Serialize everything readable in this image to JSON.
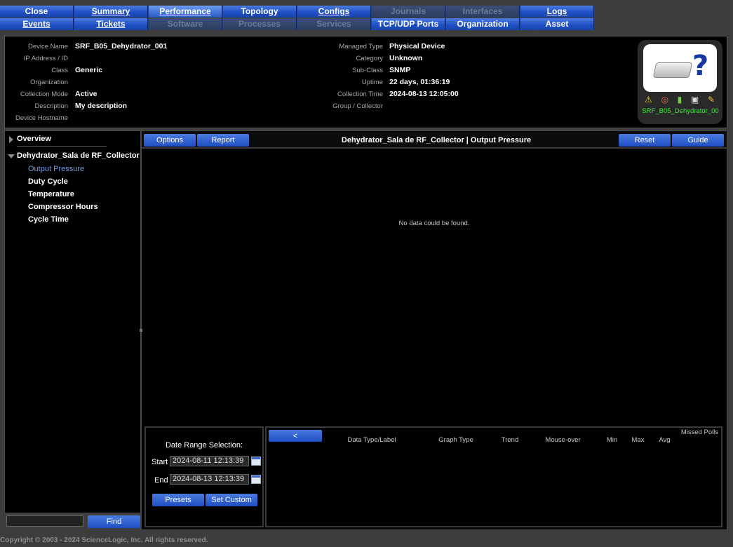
{
  "tabs_row1": [
    {
      "label": "Close",
      "accel": "",
      "state": "normal"
    },
    {
      "label": "Summary",
      "accel": "S",
      "state": "normal"
    },
    {
      "label": "Performance",
      "accel": "P",
      "state": "active"
    },
    {
      "label": "Topology",
      "accel": "o",
      "state": "normal"
    },
    {
      "label": "Configs",
      "accel": "C",
      "state": "normal"
    },
    {
      "label": "Journals",
      "accel": "",
      "state": "disabled"
    },
    {
      "label": "Interfaces",
      "accel": "",
      "state": "disabled"
    },
    {
      "label": "Logs",
      "accel": "L",
      "state": "normal"
    }
  ],
  "tabs_row2": [
    {
      "label": "Events",
      "accel": "E",
      "state": "normal"
    },
    {
      "label": "Tickets",
      "accel": "T",
      "state": "normal"
    },
    {
      "label": "Software",
      "accel": "",
      "state": "disabled"
    },
    {
      "label": "Processes",
      "accel": "",
      "state": "disabled"
    },
    {
      "label": "Services",
      "accel": "",
      "state": "disabled"
    },
    {
      "label": "TCP/UDP Ports",
      "accel": "",
      "state": "normal"
    },
    {
      "label": "Organization",
      "accel": "",
      "state": "normal"
    },
    {
      "label": "Asset",
      "accel": "",
      "state": "normal"
    }
  ],
  "device": {
    "left": [
      {
        "key": "Device Name",
        "value": "SRF_B05_Dehydrator_001"
      },
      {
        "key": "IP Address / ID",
        "value": ""
      },
      {
        "key": "Class",
        "value": "Generic"
      },
      {
        "key": "Organization",
        "value": ""
      },
      {
        "key": "Collection Mode",
        "value": "Active"
      },
      {
        "key": "Description",
        "value": "My description"
      },
      {
        "key": "Device Hostname",
        "value": ""
      }
    ],
    "right": [
      {
        "key": "Managed Type",
        "value": "Physical Device"
      },
      {
        "key": "Category",
        "value": "Unknown"
      },
      {
        "key": "Sub-Class",
        "value": "SNMP"
      },
      {
        "key": "Uptime",
        "value": "22 days, 01:36:19"
      },
      {
        "key": "Collection Time",
        "value": "2024-08-13 12:05:00"
      },
      {
        "key": "Group / Collector",
        "value": ""
      }
    ],
    "badge_name": "SRF_B05_Dehydrator_00"
  },
  "nav": {
    "overview": "Overview",
    "group": "Dehydrator_Sala de RF_Collector",
    "items": [
      {
        "label": "Output Pressure",
        "selected": true
      },
      {
        "label": "Duty Cycle",
        "selected": false
      },
      {
        "label": "Temperature",
        "selected": false
      },
      {
        "label": "Compressor Hours",
        "selected": false
      },
      {
        "label": "Cycle Time",
        "selected": false
      }
    ],
    "find_label": "Find"
  },
  "toolbar": {
    "options": "Options",
    "report": "Report",
    "title": "Dehydrator_Sala de RF_Collector | Output Pressure",
    "reset": "Reset",
    "guide": "Guide"
  },
  "graph": {
    "empty_message": "No data could be found."
  },
  "date_range": {
    "title": "Date Range Selection:",
    "start_label": "Start",
    "start_value": "2024-08-11 12:13:39",
    "end_label": "End",
    "end_value": "2024-08-13 12:13:39",
    "presets": "Presets",
    "set_custom": "Set Custom"
  },
  "legend": {
    "back": "<",
    "columns": [
      "Data Type/Label",
      "Graph Type",
      "Trend",
      "Mouse-over",
      "Min",
      "Max",
      "Avg",
      "Missed Polls"
    ]
  },
  "footer": {
    "copyright": "Copyright © 2003 - 2024 ScienceLogic, Inc. All rights reserved."
  }
}
